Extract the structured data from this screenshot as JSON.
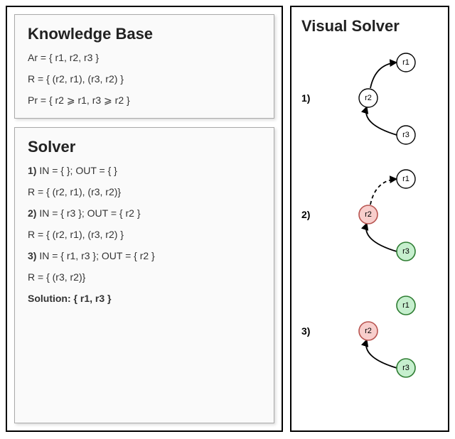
{
  "kb": {
    "title": "Knowledge Base",
    "line1": "Ar = { r1, r2, r3 }",
    "line2": "R = { (r2, r1), (r3, r2) }",
    "line3": "Pr = { r2 ⩾ r1, r3 ⩾ r2 }"
  },
  "solver": {
    "title": "Solver",
    "step1_label": "1)",
    "step1_text": " IN =  { }; OUT = { }",
    "r1": "R = { (r2, r1), (r3, r2)}",
    "step2_label": "2)",
    "step2_text": " IN = { r3 }; OUT = { r2 }",
    "r2": "R = { (r2, r1), (r3, r2) }",
    "step3_label": "3)",
    "step3_text": " IN = { r1, r3 }; OUT = { r2 }",
    "r3": "R = { (r3, r2)}",
    "solution_label": "Solution: { r1, r3 }"
  },
  "visual": {
    "title": "Visual Solver",
    "step1": "1)",
    "step2": "2)",
    "step3": "3)"
  },
  "nodes": {
    "r1": "r1",
    "r2": "r2",
    "r3": "r3"
  },
  "colors": {
    "green_fill": "#c6efce",
    "green_stroke": "#2e7d32",
    "red_fill": "#f8cecc",
    "red_stroke": "#b85450"
  }
}
